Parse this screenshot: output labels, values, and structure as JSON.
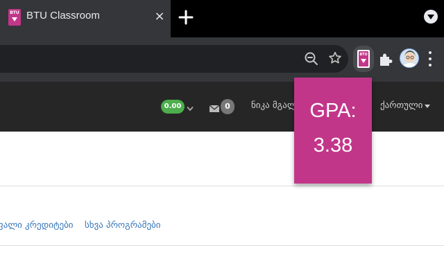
{
  "browser": {
    "tab": {
      "title": "BTU Classroom",
      "favicon_text": "BTU",
      "close_glyph": "×"
    },
    "new_tab_glyph": "+",
    "toolbar_icons": [
      "zoom-out-icon",
      "bookmark-star-icon",
      "btu-extension-icon",
      "puzzle-extensions-icon",
      "profile-avatar",
      "more-menu-icon"
    ]
  },
  "navbar": {
    "gpa_badge": "0.00",
    "messages_count": "0",
    "user_name": "ნიკა მგალო",
    "language": "ქართული"
  },
  "page": {
    "links": [
      "ფალი კრედიტები",
      "სხვა პროგრამები"
    ]
  },
  "popup": {
    "label": "GPA:",
    "value": "3.38"
  },
  "colors": {
    "accent": "#c2368a",
    "badge_green": "#4cae4c",
    "link_blue": "#3374b8",
    "navbar_bg": "#262626",
    "chrome_dark": "#35363a"
  }
}
